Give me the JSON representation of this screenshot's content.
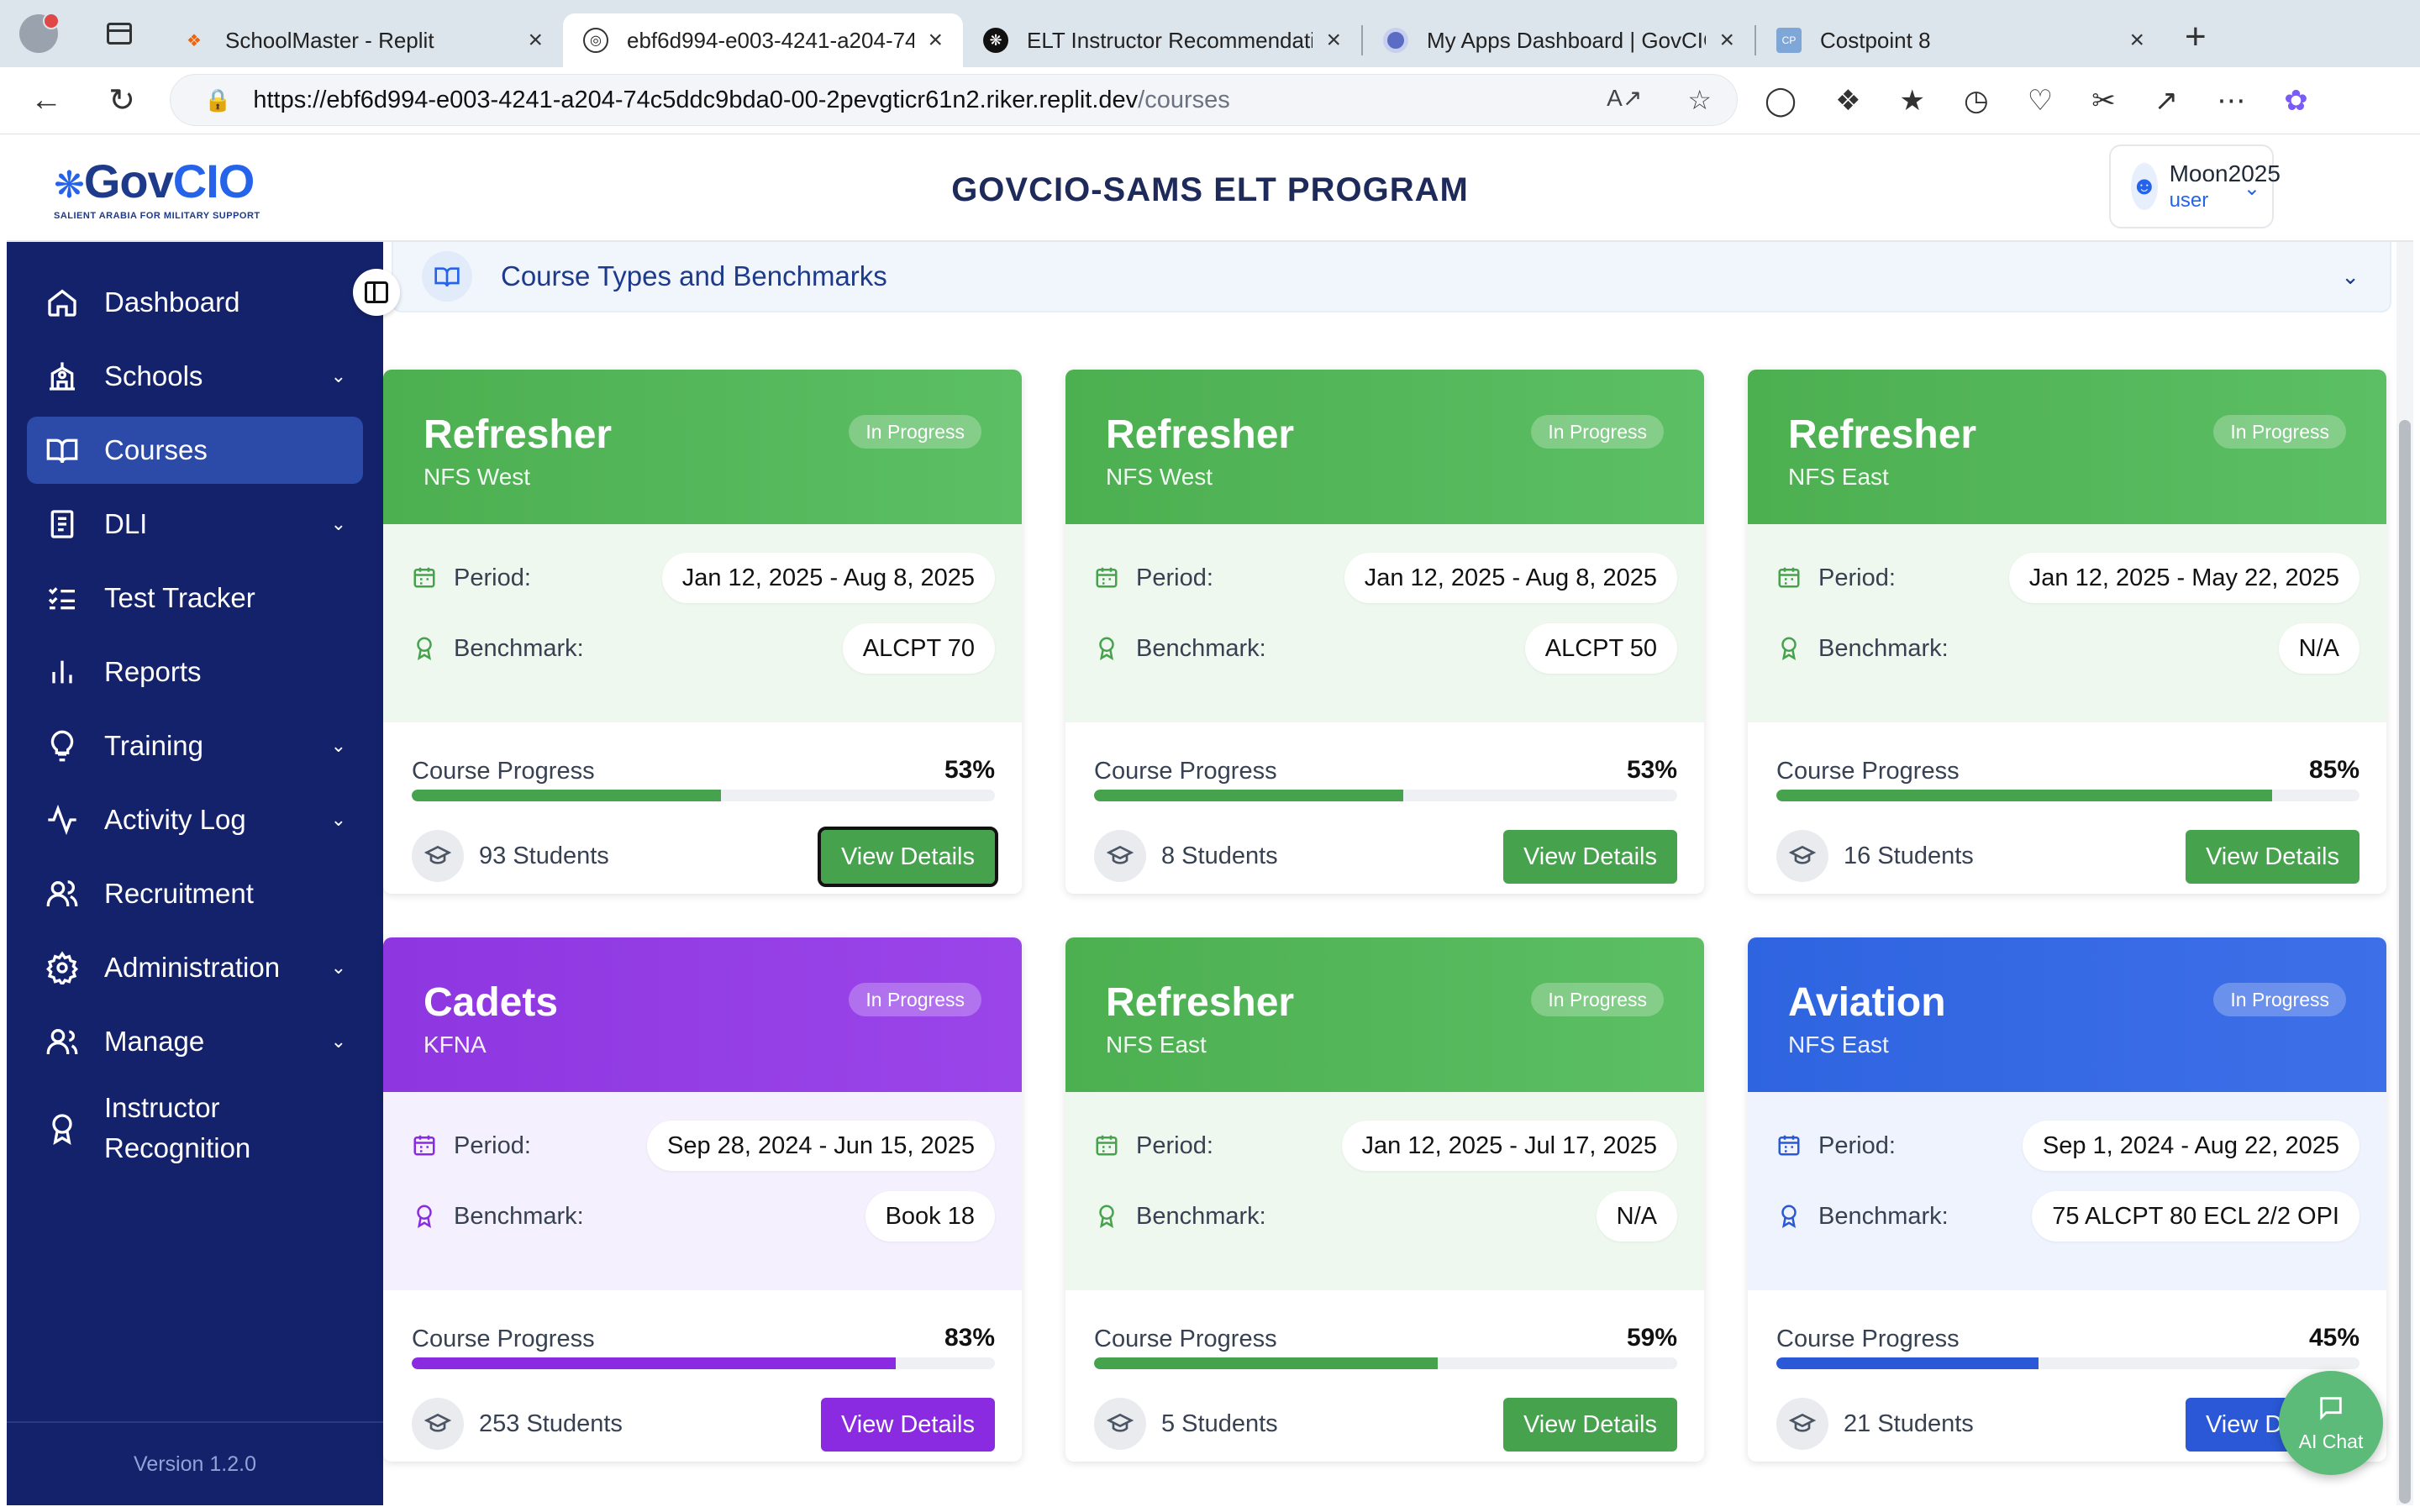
{
  "browser": {
    "tabs": [
      {
        "title": "SchoolMaster - Replit",
        "favicon": "replit-icon",
        "active": false
      },
      {
        "title": "ebf6d994-e003-4241-a204-74",
        "favicon": "globe-icon",
        "active": true
      },
      {
        "title": "ELT Instructor Recommendation",
        "favicon": "openai-icon",
        "active": false
      },
      {
        "title": "My Apps Dashboard | GovCIO",
        "favicon": "okta-icon",
        "active": false
      },
      {
        "title": "Costpoint 8",
        "favicon": "costpoint-icon",
        "active": false
      }
    ],
    "url_host": "https://ebf6d994-e003-4241-a204-74c5ddc9bda0-00-2pevgticr61n2.riker.replit.dev",
    "url_path": "/courses"
  },
  "header": {
    "logo_text_a": "Gov",
    "logo_text_b": "CIO",
    "logo_sub": "SALIENT ARABIA FOR MILITARY SUPPORT",
    "title": "GOVCIO-SAMS ELT PROGRAM",
    "user_name": "Moon2025",
    "user_role": "user"
  },
  "sidebar": {
    "items": [
      {
        "label": "Dashboard",
        "icon": "home-icon",
        "has_caret": false,
        "active": false
      },
      {
        "label": "Schools",
        "icon": "school-icon",
        "has_caret": true,
        "active": false
      },
      {
        "label": "Courses",
        "icon": "book-open-icon",
        "has_caret": false,
        "active": true
      },
      {
        "label": "DLI",
        "icon": "notebook-icon",
        "has_caret": true,
        "active": false
      },
      {
        "label": "Test Tracker",
        "icon": "checklist-icon",
        "has_caret": false,
        "active": false
      },
      {
        "label": "Reports",
        "icon": "bar-chart-icon",
        "has_caret": false,
        "active": false
      },
      {
        "label": "Training",
        "icon": "lightbulb-icon",
        "has_caret": true,
        "active": false
      },
      {
        "label": "Activity Log",
        "icon": "activity-icon",
        "has_caret": true,
        "active": false
      },
      {
        "label": "Recruitment",
        "icon": "users-icon",
        "has_caret": false,
        "active": false
      },
      {
        "label": "Administration",
        "icon": "gear-icon",
        "has_caret": true,
        "active": false
      },
      {
        "label": "Manage",
        "icon": "user-group-icon",
        "has_caret": true,
        "active": false
      },
      {
        "label_line1": "Instructor",
        "label_line2": "Recognition",
        "icon": "award-icon",
        "has_caret": false,
        "active": false
      }
    ],
    "version": "Version 1.2.0"
  },
  "accordion": {
    "title": "Course Types and Benchmarks"
  },
  "labels": {
    "period": "Period:",
    "benchmark": "Benchmark:",
    "course_progress": "Course Progress",
    "view_details": "View Details",
    "students_suffix": "Students"
  },
  "courses": [
    {
      "type": "Refresher",
      "location": "NFS West",
      "status": "In Progress",
      "period": "Jan 12, 2025 - Aug 8, 2025",
      "benchmark": "ALCPT 70",
      "progress_pct": 53,
      "progress_text": "53%",
      "students": "93 Students",
      "theme": "green",
      "focused": true
    },
    {
      "type": "Refresher",
      "location": "NFS West",
      "status": "In Progress",
      "period": "Jan 12, 2025 - Aug 8, 2025",
      "benchmark": "ALCPT 50",
      "progress_pct": 53,
      "progress_text": "53%",
      "students": "8 Students",
      "theme": "green",
      "focused": false
    },
    {
      "type": "Refresher",
      "location": "NFS East",
      "status": "In Progress",
      "period": "Jan 12, 2025 - May 22, 2025",
      "benchmark": "N/A",
      "progress_pct": 85,
      "progress_text": "85%",
      "students": "16 Students",
      "theme": "green",
      "focused": false
    },
    {
      "type": "Cadets",
      "location": "KFNA",
      "status": "In Progress",
      "period": "Sep 28, 2024 - Jun 15, 2025",
      "benchmark": "Book 18",
      "progress_pct": 83,
      "progress_text": "83%",
      "students": "253 Students",
      "theme": "purple",
      "focused": false
    },
    {
      "type": "Refresher",
      "location": "NFS East",
      "status": "In Progress",
      "period": "Jan 12, 2025 - Jul 17, 2025",
      "benchmark": "N/A",
      "progress_pct": 59,
      "progress_text": "59%",
      "students": "5 Students",
      "theme": "green",
      "focused": false
    },
    {
      "type": "Aviation",
      "location": "NFS East",
      "status": "In Progress",
      "period": "Sep 1, 2024 - Aug 22, 2025",
      "benchmark": "75 ALCPT 80 ECL 2/2 OPI",
      "progress_pct": 45,
      "progress_text": "45%",
      "students": "21 Students",
      "theme": "blue",
      "focused": false
    }
  ],
  "themes": {
    "green": {
      "head": "#4caf50",
      "head2": "#5cbf64",
      "meta_bg": "#eef8ee",
      "accent": "#46a24d",
      "btn": "#46a24d"
    },
    "purple": {
      "head": "#8e36e0",
      "head2": "#9a45ea",
      "meta_bg": "#f5f0fd",
      "accent": "#8a2be2",
      "btn": "#8a2be2"
    },
    "blue": {
      "head": "#2f64e0",
      "head2": "#3d6fe8",
      "meta_bg": "#eef3fd",
      "accent": "#2a58d6",
      "btn": "#2a58d6"
    }
  },
  "ai_chat": {
    "label": "AI Chat"
  }
}
